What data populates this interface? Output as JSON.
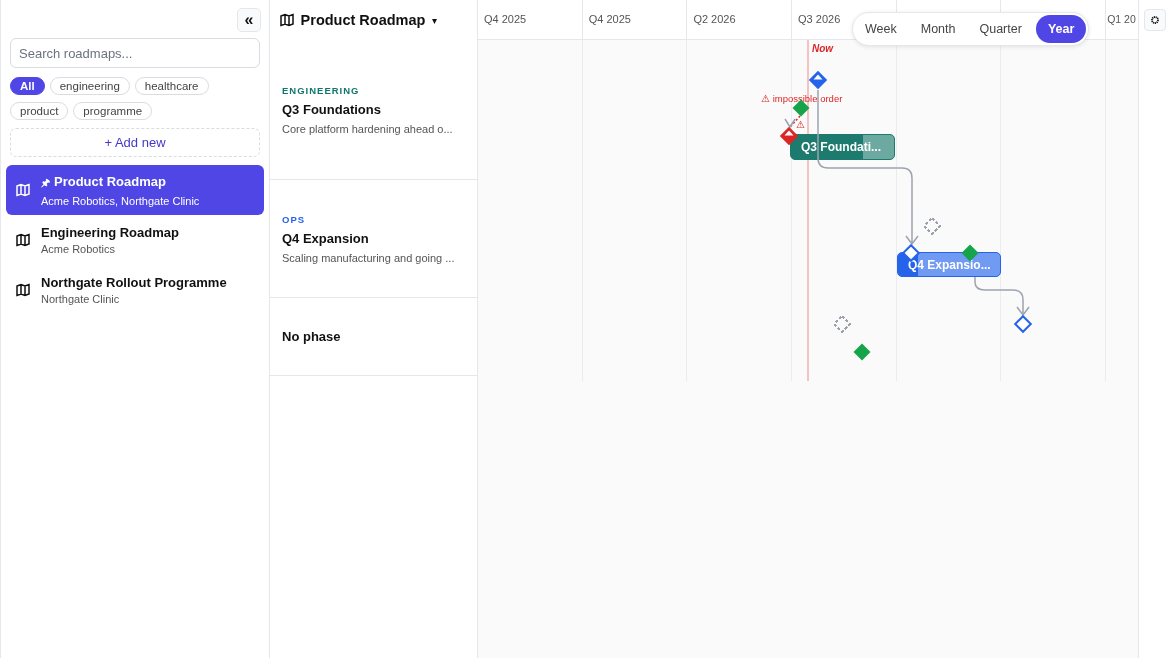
{
  "sidebar": {
    "collapse_button": "«",
    "search": {
      "placeholder": "Search roadmaps..."
    },
    "filters": [
      {
        "label": "All",
        "selected": true
      },
      {
        "label": "engineering",
        "selected": false
      },
      {
        "label": "healthcare",
        "selected": false
      },
      {
        "label": "product",
        "selected": false
      },
      {
        "label": "programme",
        "selected": false
      }
    ],
    "add_button": "+ Add new",
    "roadmaps": [
      {
        "title": "Product Roadmap",
        "pin": "🖈",
        "subtitle": "Acme Robotics, Northgate Clinic",
        "selected": true
      },
      {
        "title": "Engineering Roadmap",
        "subtitle": "Acme Robotics",
        "selected": false
      },
      {
        "title": "Northgate Rollout Programme",
        "subtitle": "Northgate Clinic",
        "selected": false
      }
    ]
  },
  "header": {
    "title": "Product Roadmap",
    "caret": "▾"
  },
  "phases": [
    {
      "tag": "ENGINEERING",
      "color": "#0f766e",
      "title": "Q3 Foundations",
      "description": "Core platform hardening ahead o..."
    },
    {
      "tag": "OPS",
      "color": "#2563eb",
      "title": "Q4 Expansion",
      "description": "Scaling manufacturing and going ..."
    },
    {
      "title": "No phase"
    }
  ],
  "timeline": {
    "columns": [
      "Q4 2025",
      "Q4 2025",
      "Q2 2026",
      "Q3 2026"
    ],
    "cut_column": "Q1 20",
    "zoom": [
      {
        "label": "Week",
        "selected": false
      },
      {
        "label": "Month",
        "selected": false
      },
      {
        "label": "Quarter",
        "selected": false
      },
      {
        "label": "Year",
        "selected": true
      }
    ],
    "now_label": "Now",
    "warning": "⚠ impossible order",
    "warning_mark": "⚠",
    "bars": [
      {
        "label": "Q3 Foundati...",
        "color": "#1d7a6e",
        "level": 0.7
      },
      {
        "label": "Q4 Expansio...",
        "color": "#2563eb",
        "level": 0.2
      }
    ],
    "milestones": [
      {
        "kind": "half",
        "color": "#2563eb"
      },
      {
        "kind": "filled",
        "color": "#16a34a"
      },
      {
        "kind": "half",
        "color": "#dc2626"
      },
      {
        "kind": "dashed",
        "color": "#9ca3af"
      },
      {
        "kind": "outline",
        "color": "#2563eb"
      },
      {
        "kind": "filled",
        "color": "#16a34a"
      },
      {
        "kind": "outline",
        "color": "#2563eb"
      },
      {
        "kind": "dashed",
        "color": "#9ca3af"
      },
      {
        "kind": "filled",
        "color": "#16a34a"
      }
    ]
  }
}
